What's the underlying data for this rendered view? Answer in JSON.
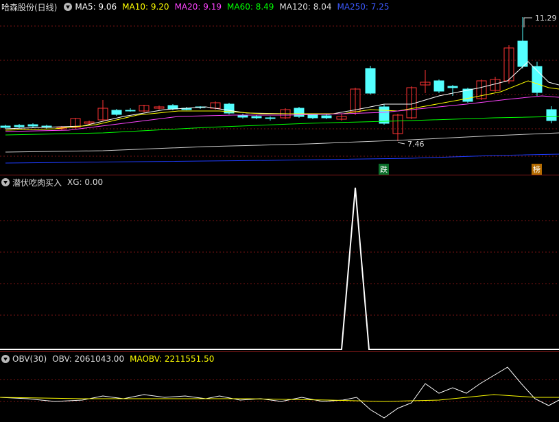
{
  "main": {
    "stock_name": "哈森股份(日线)",
    "ma5": "MA5: 9.06",
    "ma10": "MA10: 9.20",
    "ma20": "MA20: 9.19",
    "ma60": "MA60: 8.49",
    "ma120": "MA120: 8.04",
    "ma250": "MA250: 7.25",
    "high_label": "11.29",
    "low_label": "7.46",
    "tag_down": "跌",
    "tag_rank": "榜",
    "colors": {
      "up": "#ff3333",
      "down": "#54ffff",
      "ma5": "#ffffff",
      "ma10": "#ffff00",
      "ma20": "#ff44ff",
      "ma60": "#00ff00",
      "ma120": "#cccccc",
      "ma250": "#1e3cff"
    }
  },
  "indicator1": {
    "name": "潜伏吃肉买入",
    "xg": "XG: 0.00"
  },
  "indicator2": {
    "name": "OBV(30)",
    "obv": "OBV: 2061043.00",
    "maobv": "MAOBV: 2211551.50"
  }
}
